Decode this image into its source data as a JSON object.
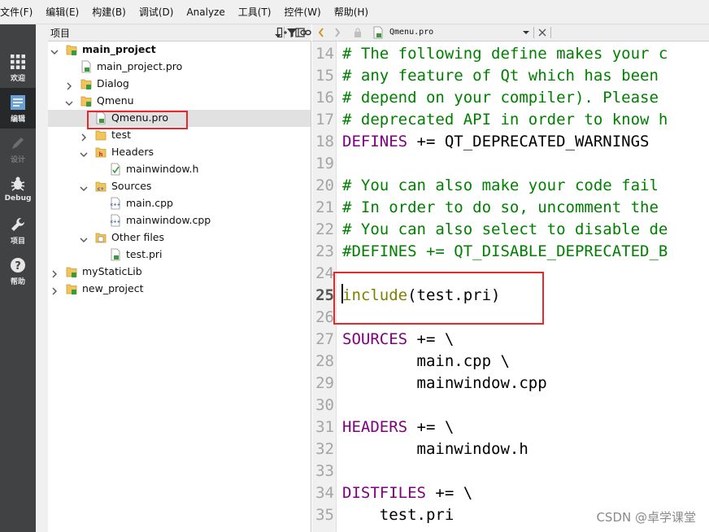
{
  "menu": [
    "文件(F)",
    "编辑(E)",
    "构建(B)",
    "调试(D)",
    "Analyze",
    "工具(T)",
    "控件(W)",
    "帮助(H)"
  ],
  "modes": [
    {
      "label": "欢迎",
      "icon": "grid-icon",
      "state": "normal"
    },
    {
      "label": "编辑",
      "icon": "edit-document-icon",
      "state": "active"
    },
    {
      "label": "设计",
      "icon": "pencil-icon",
      "state": "disabled"
    },
    {
      "label": "Debug",
      "icon": "bug-icon",
      "state": "normal"
    },
    {
      "label": "项目",
      "icon": "wrench-icon",
      "state": "normal"
    },
    {
      "label": "帮助",
      "icon": "help-icon",
      "state": "normal"
    }
  ],
  "project_pane": {
    "title": "项目",
    "toolbar_icons": [
      "filter-icon",
      "link-icon",
      "split-icon",
      "close-pane-icon"
    ]
  },
  "tree": [
    {
      "label": "main_project",
      "bold": true,
      "expander": "expanded",
      "icon": "project-folder-icon"
    },
    {
      "label": "main_project.pro",
      "expander": "none",
      "icon": "pro-file-icon"
    },
    {
      "label": "Dialog",
      "expander": "collapsed",
      "icon": "project-folder-icon"
    },
    {
      "label": "Qmenu",
      "expander": "expanded",
      "icon": "project-folder-icon"
    },
    {
      "label": "Qmenu.pro",
      "expander": "none",
      "icon": "pro-file-icon",
      "selected": true
    },
    {
      "label": "test",
      "expander": "collapsed",
      "icon": "folder-icon"
    },
    {
      "label": "Headers",
      "expander": "expanded",
      "icon": "headers-folder-icon"
    },
    {
      "label": "mainwindow.h",
      "expander": "none",
      "icon": "header-file-icon"
    },
    {
      "label": "Sources",
      "expander": "expanded",
      "icon": "sources-folder-icon"
    },
    {
      "label": "main.cpp",
      "expander": "none",
      "icon": "cpp-file-icon"
    },
    {
      "label": "mainwindow.cpp",
      "expander": "none",
      "icon": "cpp-file-icon"
    },
    {
      "label": "Other files",
      "expander": "expanded",
      "icon": "other-files-folder-icon"
    },
    {
      "label": "test.pri",
      "expander": "none",
      "icon": "pri-file-icon"
    },
    {
      "label": "myStaticLib",
      "expander": "collapsed",
      "icon": "project-folder-icon"
    },
    {
      "label": "new_project",
      "expander": "collapsed",
      "icon": "project-folder-icon"
    }
  ],
  "editor": {
    "filename": "Qmenu.pro",
    "current_line": 25,
    "lines": [
      {
        "n": "14",
        "parts": [
          {
            "t": "# The following define makes your c",
            "k": "comment"
          }
        ]
      },
      {
        "n": "15",
        "parts": [
          {
            "t": "# any feature of Qt which has been",
            "k": "comment"
          }
        ]
      },
      {
        "n": "16",
        "parts": [
          {
            "t": "# depend on your compiler). Please",
            "k": "comment"
          }
        ]
      },
      {
        "n": "17",
        "parts": [
          {
            "t": "# deprecated API in order to know h",
            "k": "comment"
          }
        ]
      },
      {
        "n": "18",
        "parts": [
          {
            "t": "DEFINES",
            "k": "var"
          },
          {
            "t": " += QT_DEPRECATED_WARNINGS",
            "k": "plain"
          }
        ]
      },
      {
        "n": "19",
        "parts": []
      },
      {
        "n": "20",
        "parts": [
          {
            "t": "# You can also make your code fail",
            "k": "comment"
          }
        ]
      },
      {
        "n": "21",
        "parts": [
          {
            "t": "# In order to do so, uncomment the",
            "k": "comment"
          }
        ]
      },
      {
        "n": "22",
        "parts": [
          {
            "t": "# You can also select to disable de",
            "k": "comment"
          }
        ]
      },
      {
        "n": "23",
        "parts": [
          {
            "t": "#DEFINES += QT_DISABLE_DEPRECATED_B",
            "k": "comment"
          }
        ]
      },
      {
        "n": "24",
        "parts": []
      },
      {
        "n": "25",
        "parts": [
          {
            "t": "include",
            "k": "func"
          },
          {
            "t": "(test.pri)",
            "k": "plain"
          }
        ]
      },
      {
        "n": "26",
        "parts": []
      },
      {
        "n": "27",
        "parts": [
          {
            "t": "SOURCES",
            "k": "var"
          },
          {
            "t": " += \\",
            "k": "plain"
          }
        ]
      },
      {
        "n": "28",
        "parts": [
          {
            "t": "        main.cpp \\",
            "k": "plain"
          }
        ]
      },
      {
        "n": "29",
        "parts": [
          {
            "t": "        mainwindow.cpp",
            "k": "plain"
          }
        ]
      },
      {
        "n": "30",
        "parts": []
      },
      {
        "n": "31",
        "parts": [
          {
            "t": "HEADERS",
            "k": "var"
          },
          {
            "t": " += \\",
            "k": "plain"
          }
        ]
      },
      {
        "n": "32",
        "parts": [
          {
            "t": "        mainwindow.h",
            "k": "plain"
          }
        ]
      },
      {
        "n": "33",
        "parts": []
      },
      {
        "n": "34",
        "parts": [
          {
            "t": "DISTFILES",
            "k": "var"
          },
          {
            "t": " += \\",
            "k": "plain"
          }
        ]
      },
      {
        "n": "35",
        "parts": [
          {
            "t": "    test.pri",
            "k": "plain"
          }
        ]
      }
    ]
  },
  "colors": {
    "highlight_box": "#e8272b",
    "comment": "#008000",
    "keyword_var": "#800080",
    "function": "#808000"
  },
  "watermark": "CSDN @卓学课堂"
}
